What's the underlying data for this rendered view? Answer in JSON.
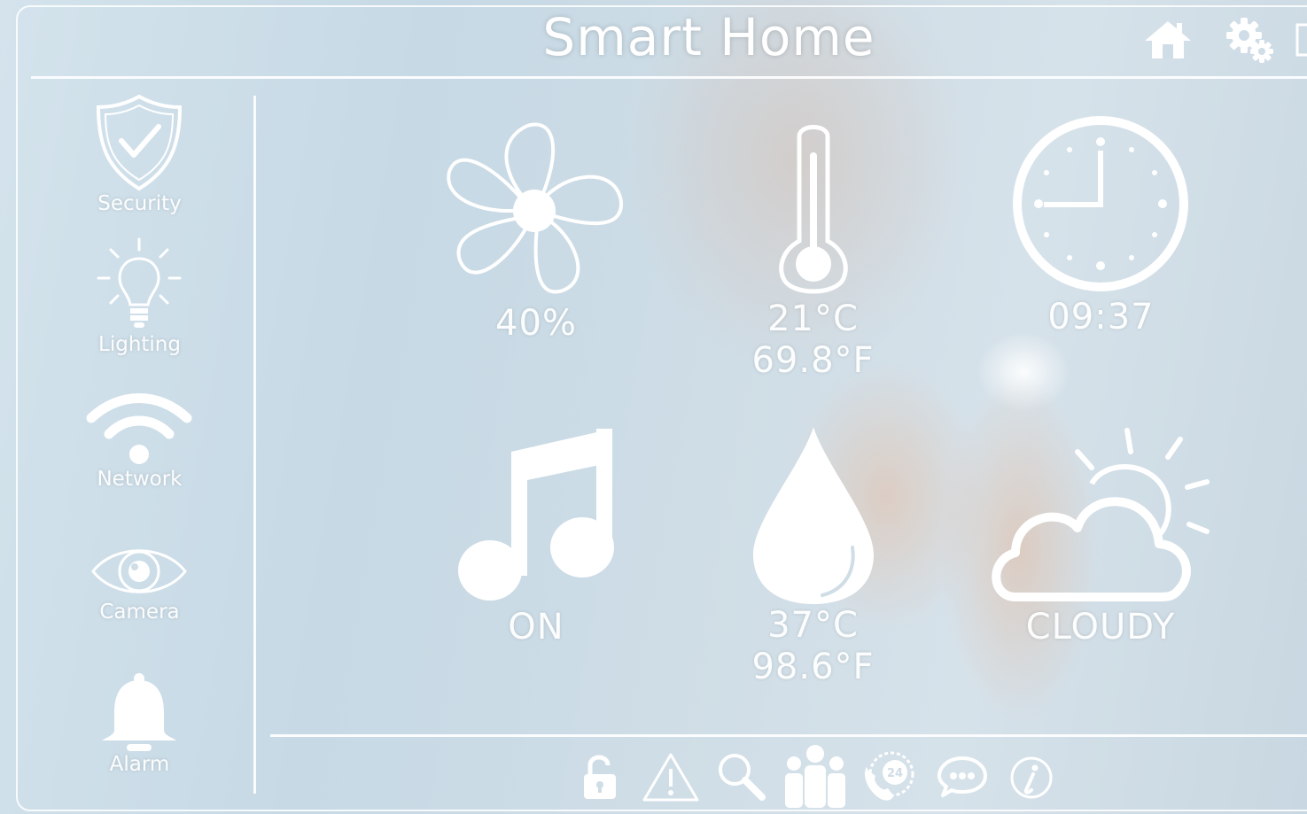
{
  "header": {
    "title": "Smart Home"
  },
  "sidebar": {
    "items": [
      {
        "label": "Security",
        "icon": "shield-check-icon"
      },
      {
        "label": "Lighting",
        "icon": "lightbulb-icon"
      },
      {
        "label": "Network",
        "icon": "wifi-icon"
      },
      {
        "label": "Camera",
        "icon": "eye-icon"
      },
      {
        "label": "Alarm",
        "icon": "bell-icon"
      }
    ]
  },
  "tiles": {
    "fan": {
      "value": "40%",
      "icon": "fan-icon"
    },
    "temperature": {
      "celsius": "21°C",
      "fahrenheit": "69.8°F",
      "icon": "thermometer-icon"
    },
    "clock": {
      "time": "09:37",
      "icon": "clock-icon"
    },
    "music": {
      "status": "ON",
      "icon": "music-note-icon"
    },
    "water": {
      "celsius": "37°C",
      "fahrenheit": "98.6°F",
      "icon": "water-drop-icon"
    },
    "weather": {
      "condition": "CLOUDY",
      "icon": "partly-cloudy-icon"
    }
  },
  "toolbar": {
    "top": [
      "home-icon",
      "settings-gears-icon",
      "window-icon"
    ],
    "bottom": [
      "unlock-icon",
      "warning-icon",
      "search-icon",
      "people-icon",
      "support-24-icon",
      "chat-icon",
      "info-icon"
    ]
  },
  "colors": {
    "accent": "#ffffff",
    "background": "#cfdde6"
  }
}
